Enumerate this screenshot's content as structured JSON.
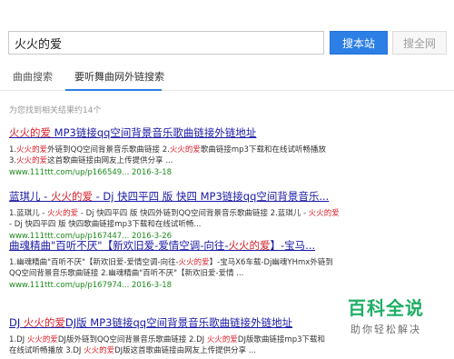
{
  "search": {
    "value": "火火的爱"
  },
  "buttons": {
    "site": "搜本站",
    "web": "搜全网"
  },
  "tabs": [
    "曲曲搜索",
    "要听舞曲网外链搜索"
  ],
  "results_count": "为您找到相关结果约14个",
  "results": [
    {
      "title": [
        [
          "火火的爱",
          true
        ],
        [
          " MP3链接qq空间背景音乐歌曲链接外链地址",
          false
        ]
      ],
      "desc1": [
        [
          "1.",
          false
        ],
        [
          "火火的爱",
          true
        ],
        [
          "外链到QQ空间背景音乐歌曲链接 2.",
          false
        ],
        [
          "火火的爱",
          true
        ],
        [
          "歌曲链接mp3下载和在线试听畅播放",
          false
        ]
      ],
      "desc2": [
        [
          "3.",
          false
        ],
        [
          "火火的爱",
          true
        ],
        [
          "这首歌曲链接由网友上传提供分享 ...",
          false
        ]
      ],
      "url": "www.111ttt.com/up/p166549... 2016-3-18"
    },
    {
      "title": [
        [
          "蓝琪儿 - ",
          false
        ],
        [
          "火火的爱",
          true
        ],
        [
          " - Dj 快四平四 版 快四 MP3链接qq空间背景音乐...",
          false
        ]
      ],
      "desc1": [
        [
          "1.蓝琪儿 - ",
          false
        ],
        [
          "火火的爱",
          true
        ],
        [
          " - Dj 快四平四 版 快四外链到QQ空间背景音乐歌曲链接 2.蓝琪儿 - ",
          false
        ],
        [
          "火火的爱",
          true
        ]
      ],
      "desc2": [
        [
          " - Dj 快四平四 版 快四歌曲链接mp3下载和在线试听畅...",
          false
        ]
      ],
      "url": "www.111ttt.com/up/p167447... 2016-3-26"
    },
    {
      "title": [
        [
          "曲魂精曲\"百听不厌\"【新欢旧爱-爱情空调-向往-",
          false
        ],
        [
          "火火的爱",
          true
        ],
        [
          "】-宝马...",
          false
        ]
      ],
      "desc1": [
        [
          "1.幽魂精曲\"百听不厌\"【新欢旧爱-爱情空调-向往-",
          false
        ],
        [
          "火火的爱",
          true
        ],
        [
          "】-宝马X6车载-Dj幽魂YHmx外链到",
          false
        ]
      ],
      "desc2": [
        [
          "QQ空间背景音乐歌曲链接 2.幽魂精曲\"百听不厌\"【新欢旧爱-爱情 ...",
          false
        ]
      ],
      "url": "www.111ttt.com/up/p167974... 2016-3-18"
    },
    {
      "title": [
        [
          "DJ ",
          false
        ],
        [
          "火火的爱",
          true
        ],
        [
          "DJ版 MP3链接qq空间背景音乐歌曲链接外链地址",
          false
        ]
      ],
      "desc1": [
        [
          "1.DJ ",
          false
        ],
        [
          "火火的爱",
          true
        ],
        [
          "DJ版外链到QQ空间背景音乐歌曲链接 2.DJ ",
          false
        ],
        [
          "火火的爱",
          true
        ],
        [
          "DJ版歌曲链接mp3下载和",
          false
        ]
      ],
      "desc2": [
        [
          "在线试听畅播放 3.DJ ",
          false
        ],
        [
          "火火的爱",
          true
        ],
        [
          "DJ版这首歌曲链接由网友上传提供分享 ...",
          false
        ]
      ],
      "url": ""
    }
  ],
  "watermark": {
    "logo": "百科全说",
    "sub": "助你轻松解决"
  },
  "colors": {
    "link": "#1a1aa6",
    "highlight": "#d6202a",
    "url": "#1d8a1d",
    "accent": "#2c7fe5",
    "brand": "#1fae66"
  }
}
